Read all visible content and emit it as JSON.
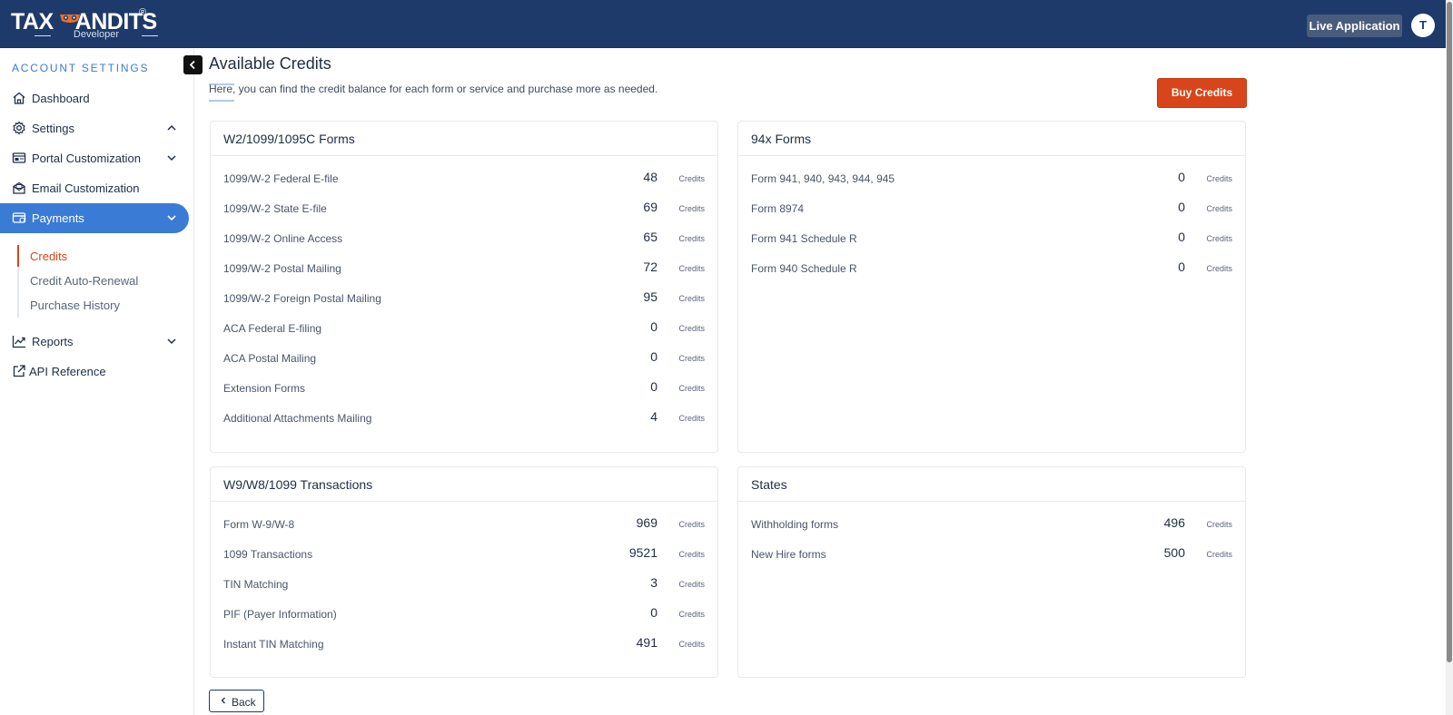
{
  "header": {
    "logo_text": "TAXBANDITS",
    "logo_reg": "®",
    "logo_sub": "Developer",
    "live_button": "Live Application",
    "avatar_initial": "T"
  },
  "sidebar": {
    "section_title": "ACCOUNT SETTINGS",
    "items": [
      {
        "label": "Dashboard",
        "icon": "home-icon"
      },
      {
        "label": "Settings",
        "icon": "gear-icon"
      },
      {
        "label": "Portal Customization",
        "icon": "portal-icon"
      },
      {
        "label": "Email Customization",
        "icon": "email-icon"
      },
      {
        "label": "Payments",
        "icon": "payment-card-icon"
      },
      {
        "label": "Reports",
        "icon": "chart-line-icon"
      },
      {
        "label": "API Reference",
        "icon": "external-link-icon"
      }
    ],
    "payments_sub": [
      {
        "label": "Credits"
      },
      {
        "label": "Credit Auto-Renewal"
      },
      {
        "label": "Purchase History"
      }
    ]
  },
  "page": {
    "title": "Available Credits",
    "description": "Here, you can find the credit balance for each form or service and purchase more as needed.",
    "buy_button": "Buy Credits",
    "back_button": "Back"
  },
  "credit_unit": "Credits",
  "cards": [
    {
      "title": "W2/1099/1095C Forms",
      "rows": [
        {
          "label": "1099/W-2 Federal E-file",
          "value": "48"
        },
        {
          "label": "1099/W-2 State E-file",
          "value": "69"
        },
        {
          "label": "1099/W-2 Online Access",
          "value": "65"
        },
        {
          "label": "1099/W-2 Postal Mailing",
          "value": "72"
        },
        {
          "label": "1099/W-2 Foreign Postal Mailing",
          "value": "95"
        },
        {
          "label": "ACA Federal E-filing",
          "value": "0"
        },
        {
          "label": "ACA Postal Mailing",
          "value": "0"
        },
        {
          "label": "Extension Forms",
          "value": "0"
        },
        {
          "label": "Additional Attachments Mailing",
          "value": "4"
        }
      ]
    },
    {
      "title": "94x Forms",
      "rows": [
        {
          "label": "Form 941, 940, 943, 944, 945",
          "value": "0"
        },
        {
          "label": "Form 8974",
          "value": "0"
        },
        {
          "label": "Form 941 Schedule R",
          "value": "0"
        },
        {
          "label": "Form 940 Schedule R",
          "value": "0"
        }
      ]
    },
    {
      "title": "W9/W8/1099 Transactions",
      "rows": [
        {
          "label": "Form W-9/W-8",
          "value": "969"
        },
        {
          "label": "1099 Transactions",
          "value": "9521"
        },
        {
          "label": "TIN Matching",
          "value": "3"
        },
        {
          "label": "PIF (Payer Information)",
          "value": "0"
        },
        {
          "label": "Instant TIN Matching",
          "value": "491"
        }
      ]
    },
    {
      "title": "States",
      "rows": [
        {
          "label": "Withholding forms",
          "value": "496"
        },
        {
          "label": "New Hire forms",
          "value": "500"
        }
      ]
    }
  ],
  "colors": {
    "header_bg": "#1e3a6a",
    "accent_blue": "#3a7bd5",
    "accent_orange": "#d9451a"
  }
}
